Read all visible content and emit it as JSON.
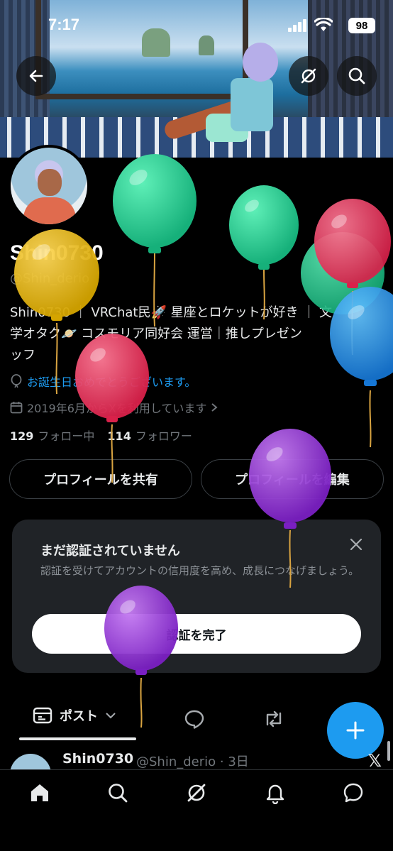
{
  "status_bar": {
    "time": "7:17",
    "battery": "98"
  },
  "header": {
    "back_icon": "arrow-left-icon",
    "grok_icon": "grok-icon",
    "search_icon": "search-icon"
  },
  "profile": {
    "display_name": "Shin0730",
    "handle": "@Shin_derio",
    "bio_line1": "Shin0730 ｜ VRChat民🚀 星座とロケットが好き ｜ 文",
    "bio_line2": "学オタク🪐 コスモリア同好会 運営｜推しプレゼン",
    "bio_line3": "ッフ",
    "birthday_text": "お誕生日おめでとうございます。",
    "joined_text": "2019年6月からXを利用しています",
    "following_count": "129",
    "following_label": "フォロー中",
    "followers_count": "114",
    "followers_label": "フォロワー"
  },
  "actions": {
    "share_label": "プロフィールを共有",
    "edit_label": "プロフィールを編集"
  },
  "verify_card": {
    "title": "まだ認証されていません",
    "description": "認証を受けてアカウントの信用度を高め、成長につなげましょう。",
    "button_label": "認証を完了"
  },
  "tabs": {
    "posts_label": "ポスト"
  },
  "post_preview": {
    "name": "Shin0730",
    "handle_time": "@Shin_derio · 3日"
  },
  "colors": {
    "accent": "#1d9bf0",
    "background": "#000000",
    "card": "#202327"
  }
}
